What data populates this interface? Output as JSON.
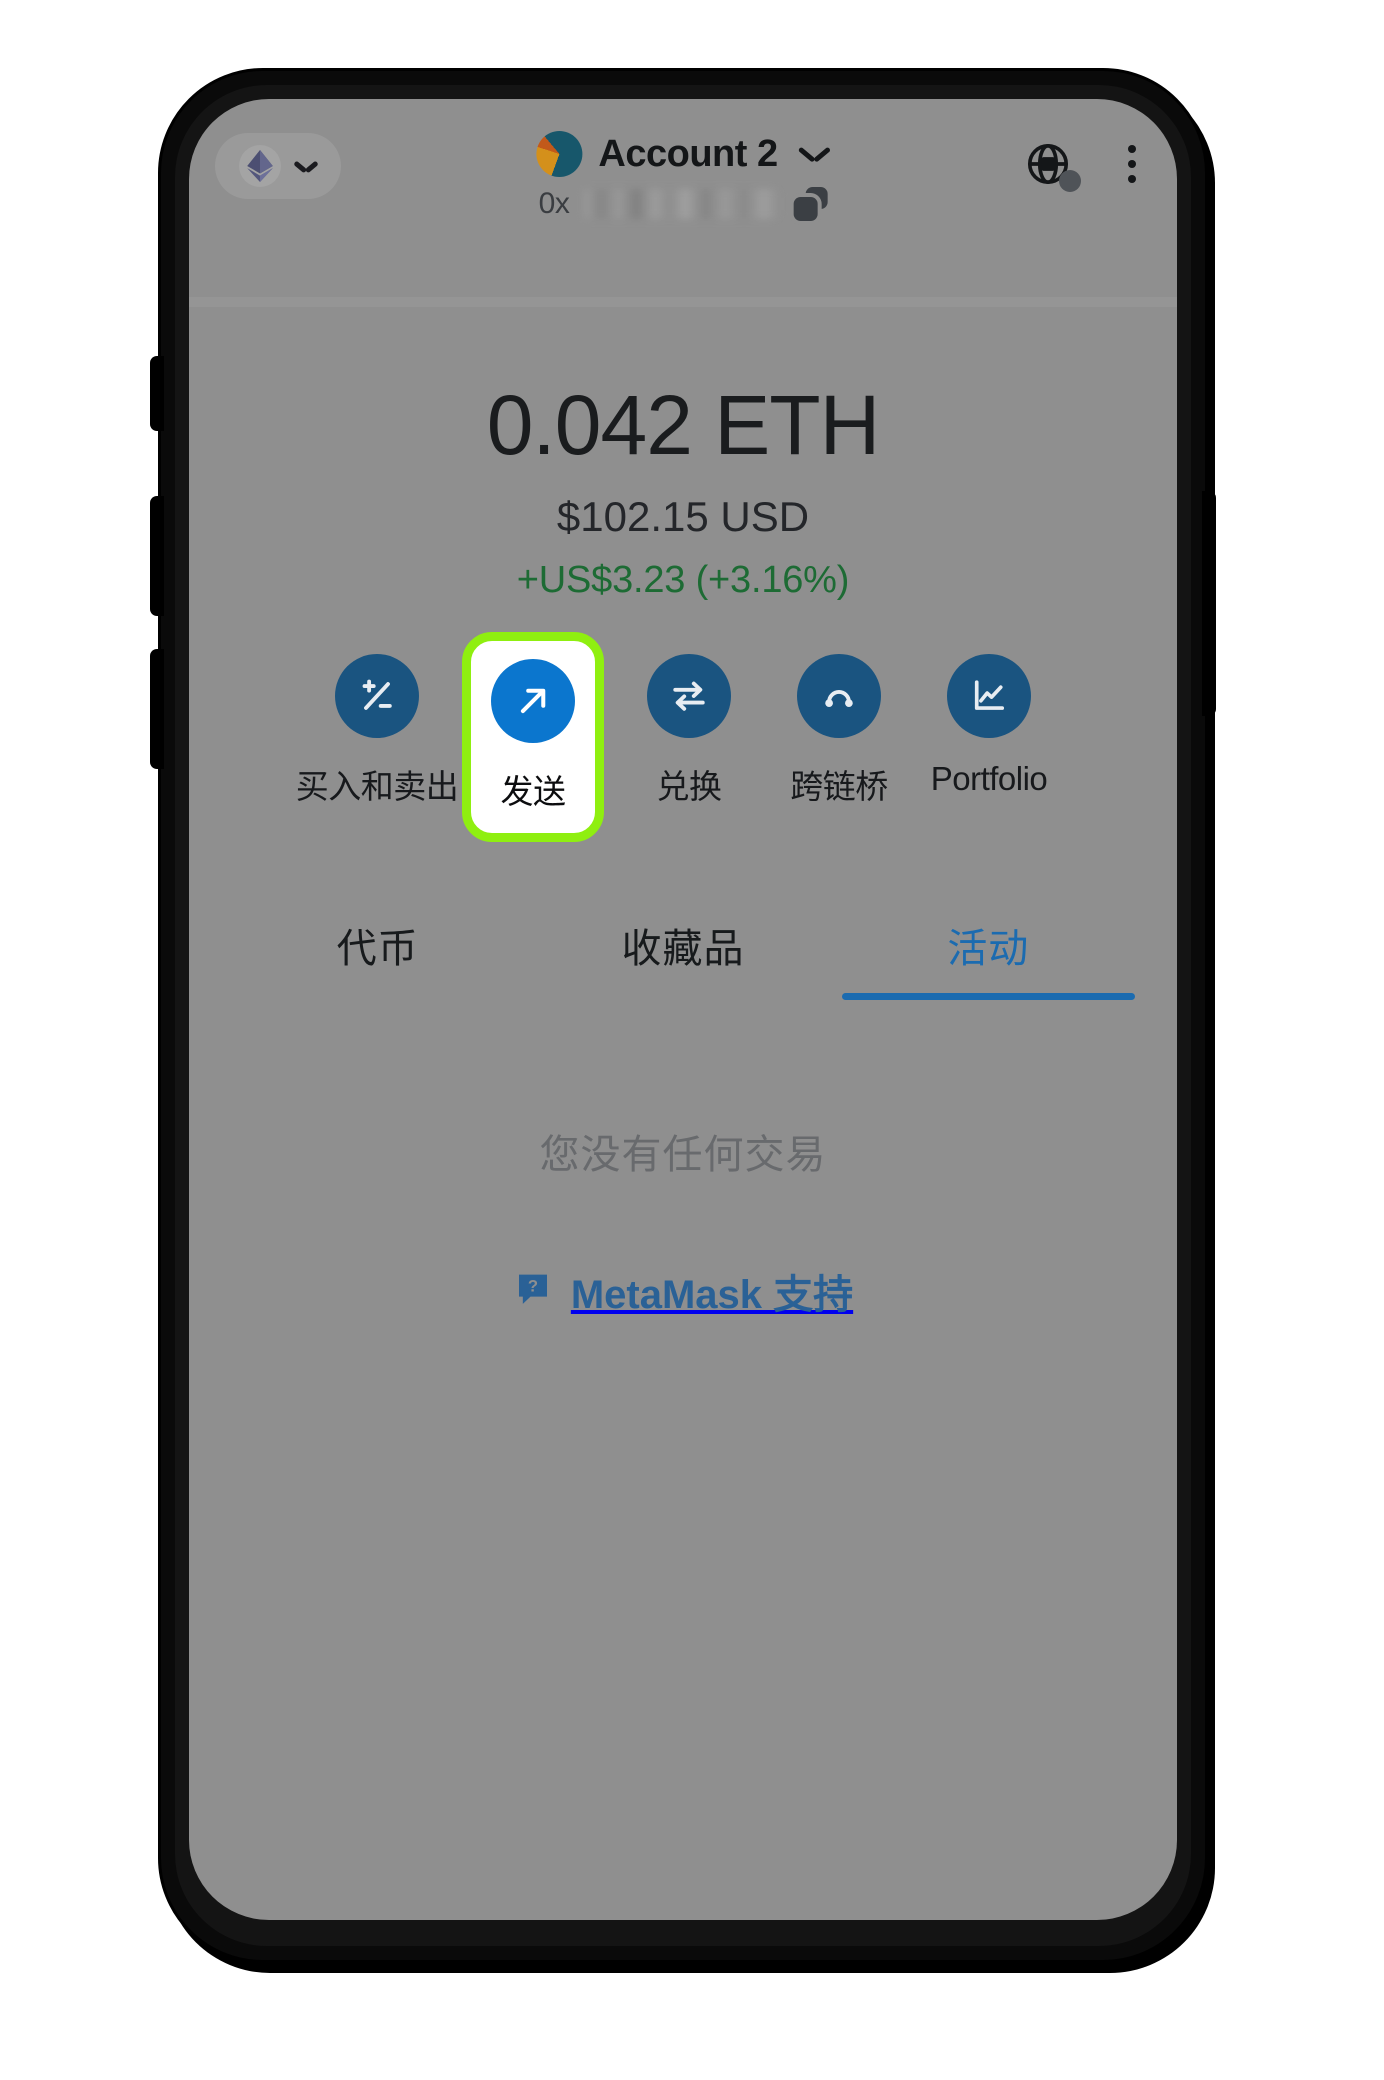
{
  "header": {
    "network_selector": {
      "icon": "ethereum-icon",
      "chevron": "chevron-down-icon"
    },
    "account_name": "Account 2",
    "account_chevron": "chevron-down-icon",
    "address_prefix": "0x",
    "address_redacted": true,
    "copy_icon": "copy-icon",
    "globe_icon": "globe-icon",
    "menu_icon": "kebab-menu-icon"
  },
  "balance": {
    "primary": "0.042 ETH",
    "fiat": "$102.15 USD",
    "change": "+US$3.23 (+3.16%)",
    "change_color": "#1d6b34"
  },
  "actions": [
    {
      "label": "买入和卖出",
      "icon": "plus-minus-icon",
      "highlighted": false
    },
    {
      "label": "发送",
      "icon": "arrow-up-right-icon",
      "highlighted": true
    },
    {
      "label": "兑换",
      "icon": "swap-arrows-icon",
      "highlighted": false
    },
    {
      "label": "跨链桥",
      "icon": "bridge-icon",
      "highlighted": false
    },
    {
      "label": "Portfolio",
      "icon": "chart-line-icon",
      "highlighted": false
    }
  ],
  "tabs": [
    {
      "label": "代币",
      "active": false
    },
    {
      "label": "收藏品",
      "active": false
    },
    {
      "label": "活动",
      "active": true
    }
  ],
  "empty_state": {
    "message": "您没有任何交易",
    "support_label": "MetaMask 支持",
    "support_icon": "help-bubble-icon"
  },
  "colors": {
    "screen_bg": "#8f8f8f",
    "accent_blue": "#0b76ce",
    "icon_blue": "#1a5480",
    "highlight_green": "#8fef10",
    "tab_active": "#1b6bb0",
    "link_blue": "#2a6196"
  }
}
